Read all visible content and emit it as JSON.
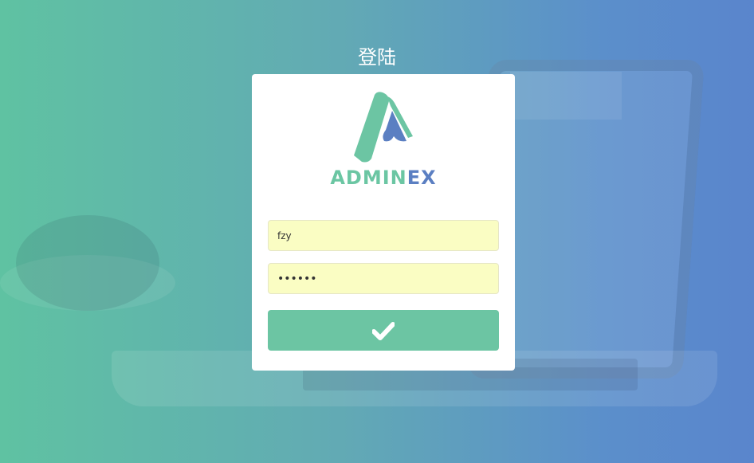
{
  "page": {
    "title": "登陆"
  },
  "brand": {
    "name_part1": "ADMIN",
    "name_part2": "EX",
    "color_primary": "#6bc6a3",
    "color_secondary": "#5b7fc2"
  },
  "login_form": {
    "username": {
      "value": "fzy"
    },
    "password": {
      "value": "••••••"
    },
    "submit": {
      "icon": "check-icon",
      "color": "#6cc5a3"
    }
  }
}
